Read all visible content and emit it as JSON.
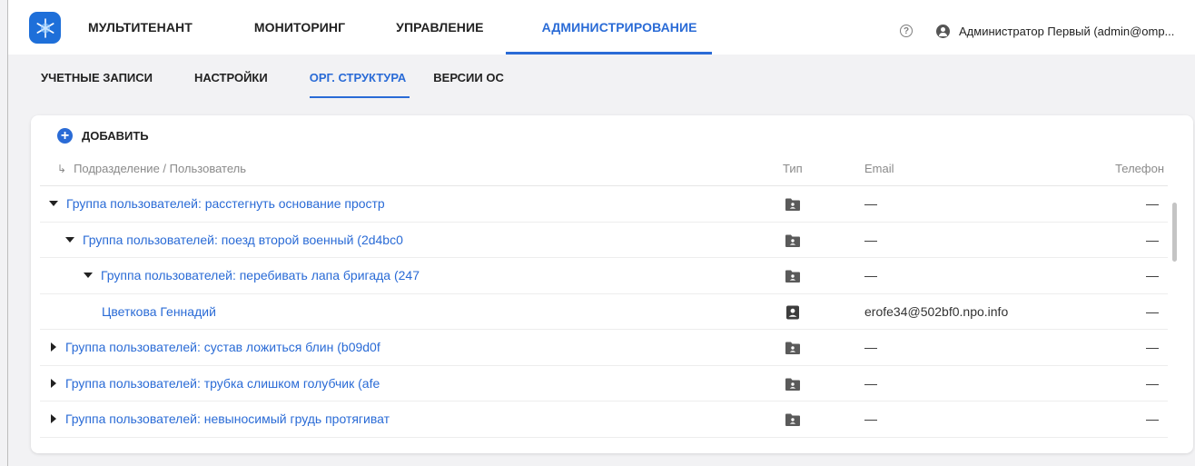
{
  "header": {
    "nav": [
      {
        "label": "МУЛЬТИТЕНАНТ",
        "active": false
      },
      {
        "label": "МОНИТОРИНГ",
        "active": false
      },
      {
        "label": "УПРАВЛЕНИЕ",
        "active": false
      },
      {
        "label": "АДМИНИСТРИРОВАНИЕ",
        "active": true
      }
    ],
    "help_icon": "question-circle-icon",
    "user_label": "Администратор Первый (admin@omp..."
  },
  "subnav": [
    {
      "label": "УЧЕТНЫЕ ЗАПИСИ",
      "active": false
    },
    {
      "label": "НАСТРОЙКИ",
      "active": false
    },
    {
      "label": "ОРГ. СТРУКТУРА",
      "active": true
    },
    {
      "label": "ВЕРСИИ ОС",
      "active": false
    }
  ],
  "toolbar": {
    "add_label": "ДОБАВИТЬ"
  },
  "table": {
    "columns": {
      "name": "Подразделение / Пользователь",
      "type": "Тип",
      "email": "Email",
      "phone": "Телефон"
    },
    "rows": [
      {
        "name": "Группа пользователей: расстегнуть основание простр",
        "expanded": true,
        "kind": "group",
        "email": "—",
        "phone": "—"
      },
      {
        "name": "Группа пользователей: поезд второй военный (2d4bc0",
        "expanded": true,
        "kind": "group",
        "email": "—",
        "phone": "—"
      },
      {
        "name": "Группа пользователей: перебивать лапа бригада (247",
        "expanded": true,
        "kind": "group",
        "email": "—",
        "phone": "—"
      },
      {
        "name": "Цветкова Геннадий",
        "expanded": false,
        "kind": "user",
        "email": "erofe34@502bf0.npo.info",
        "phone": "—"
      },
      {
        "name": "Группа пользователей: сустав ложиться блин (b09d0f",
        "expanded": false,
        "kind": "group",
        "email": "—",
        "phone": "—"
      },
      {
        "name": "Группа пользователей: трубка слишком голубчик (afe",
        "expanded": false,
        "kind": "group",
        "email": "—",
        "phone": "—"
      },
      {
        "name": "Группа пользователей: невыносимый грудь протягиват",
        "expanded": false,
        "kind": "group",
        "email": "—",
        "phone": "—"
      }
    ]
  },
  "colors": {
    "accent": "#2a6bd6",
    "logo": "#1e6fd9"
  }
}
